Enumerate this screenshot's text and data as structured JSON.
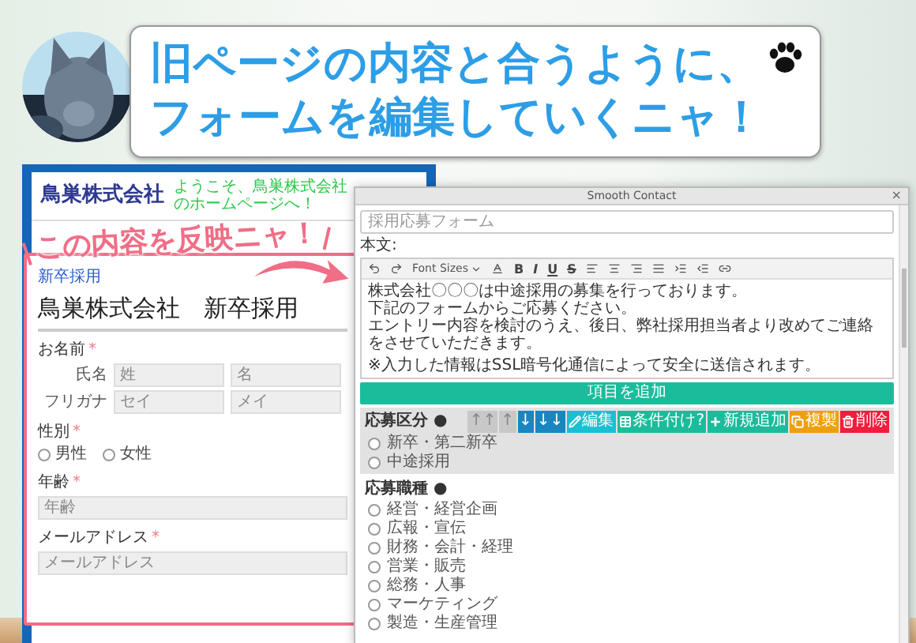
{
  "speech_bubble": {
    "lines": [
      "旧ページの内容と合うように、",
      "フォームを編集していくニャ！"
    ]
  },
  "old_page": {
    "company_name": "鳥巣株式会社",
    "welcome": "ようこそ、鳥巣株式会社のホームページへ！",
    "callout": "この内容を反映ニャ！",
    "tag": "新卒採用",
    "heading": "鳥巣株式会社　新卒採用",
    "fields": [
      {
        "kind": "name",
        "label": "お名前",
        "required_mark": "*",
        "rows": [
          {
            "label": "氏名",
            "inputs": [
              {
                "placeholder": "姓"
              },
              {
                "placeholder": "名"
              }
            ]
          },
          {
            "label": "フリガナ",
            "inputs": [
              {
                "placeholder": "セイ"
              },
              {
                "placeholder": "メイ"
              }
            ]
          }
        ]
      },
      {
        "kind": "radio",
        "label": "性別",
        "required_mark": "*",
        "options": [
          {
            "label": "男性",
            "selected": false
          },
          {
            "label": "女性",
            "selected": false
          }
        ]
      },
      {
        "kind": "text",
        "label": "年齢",
        "required_mark": "*",
        "placeholder": "年齢"
      },
      {
        "kind": "text",
        "label": "メールアドレス",
        "required_mark": "*",
        "placeholder": "メールアドレス"
      }
    ]
  },
  "editor_window": {
    "title": "Smooth Contact",
    "close": "×",
    "form_title": {
      "placeholder": "採用応募フォーム"
    },
    "body_label": "本文:",
    "toolbar": {
      "font_sizes": "Font Sizes",
      "format_letters": [
        "B",
        "I",
        "U",
        "S"
      ]
    },
    "body_paragraphs": [
      "株式会社〇〇〇は中途採用の募集を行っております。",
      "下記のフォームからご応募ください。",
      "エントリー内容を検討のうえ、後日、弊社採用担当者より改めてご連絡をさせていただきます。",
      "※入力した情報はSSL暗号化通信によって安全に送信されます。"
    ],
    "add_button": "項目を追加",
    "items": [
      {
        "label": "応募区分 ●",
        "selected": true,
        "buttons": [
          {
            "kind": "move",
            "label": "↑↑",
            "disabled": true,
            "color": "#c8c8c8"
          },
          {
            "kind": "move",
            "label": "↑",
            "disabled": true,
            "color": "#c8c8c8"
          },
          {
            "kind": "move",
            "label": "↓",
            "disabled": false,
            "color": "#1a86c0"
          },
          {
            "kind": "move",
            "label": "↓↓",
            "disabled": false,
            "color": "#1a86c0"
          },
          {
            "kind": "edit",
            "label": "編集",
            "disabled": false,
            "color": "#18c0d2"
          },
          {
            "kind": "condition",
            "label": "条件付け?",
            "disabled": false,
            "color": "#1bbc9b"
          },
          {
            "kind": "add",
            "label": "新規追加",
            "disabled": false,
            "color": "#1bbc9b"
          },
          {
            "kind": "copy",
            "label": "複製",
            "disabled": false,
            "color": "#eda00e"
          },
          {
            "kind": "delete",
            "label": "削除",
            "disabled": false,
            "color": "#f01e3c"
          }
        ],
        "options": [
          {
            "label": "新卒・第二新卒",
            "selected": false
          },
          {
            "label": "中途採用",
            "selected": false
          }
        ]
      },
      {
        "label": "応募職種 ●",
        "selected": false,
        "options": [
          {
            "label": "経営・経営企画",
            "selected": false
          },
          {
            "label": "広報・宣伝",
            "selected": false
          },
          {
            "label": "財務・会計・経理",
            "selected": false
          },
          {
            "label": "営業・販売",
            "selected": false
          },
          {
            "label": "総務・人事",
            "selected": false
          },
          {
            "label": "マーケティング",
            "selected": false
          },
          {
            "label": "製造・生産管理",
            "selected": false
          }
        ]
      }
    ]
  }
}
